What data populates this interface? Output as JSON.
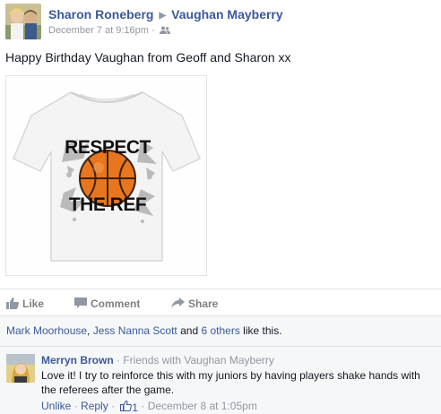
{
  "post": {
    "author": "Sharon Roneberg",
    "recipient": "Vaughan Mayberry",
    "date": "December 7 at 9:16pm",
    "text": "Happy Birthday Vaughan from Geoff and Sharon xx",
    "shirt_text_top": "RESPECT",
    "shirt_text_bottom": "THE REF"
  },
  "actions": {
    "like": "Like",
    "comment": "Comment",
    "share": "Share"
  },
  "likes": {
    "name1": "Mark Moorhouse",
    "sep": ", ",
    "name2": "Jess Nanna Scott",
    "and": " and ",
    "others": "6 others",
    "suffix": " like this."
  },
  "comment": {
    "author": "Merryn Brown",
    "relation": " · Friends with Vaughan Mayberry",
    "text": "Love it! I try to reinforce this with my juniors by having players shake hands with the referees after the game.",
    "unlike": "Unlike",
    "dot": " · ",
    "reply": "Reply",
    "like_count": "1",
    "date": "December 8 at 1:05pm"
  },
  "colors": {
    "link_blue": "#3b5998",
    "meta_gray": "#9197a3",
    "basketball_orange": "#e8761f"
  }
}
